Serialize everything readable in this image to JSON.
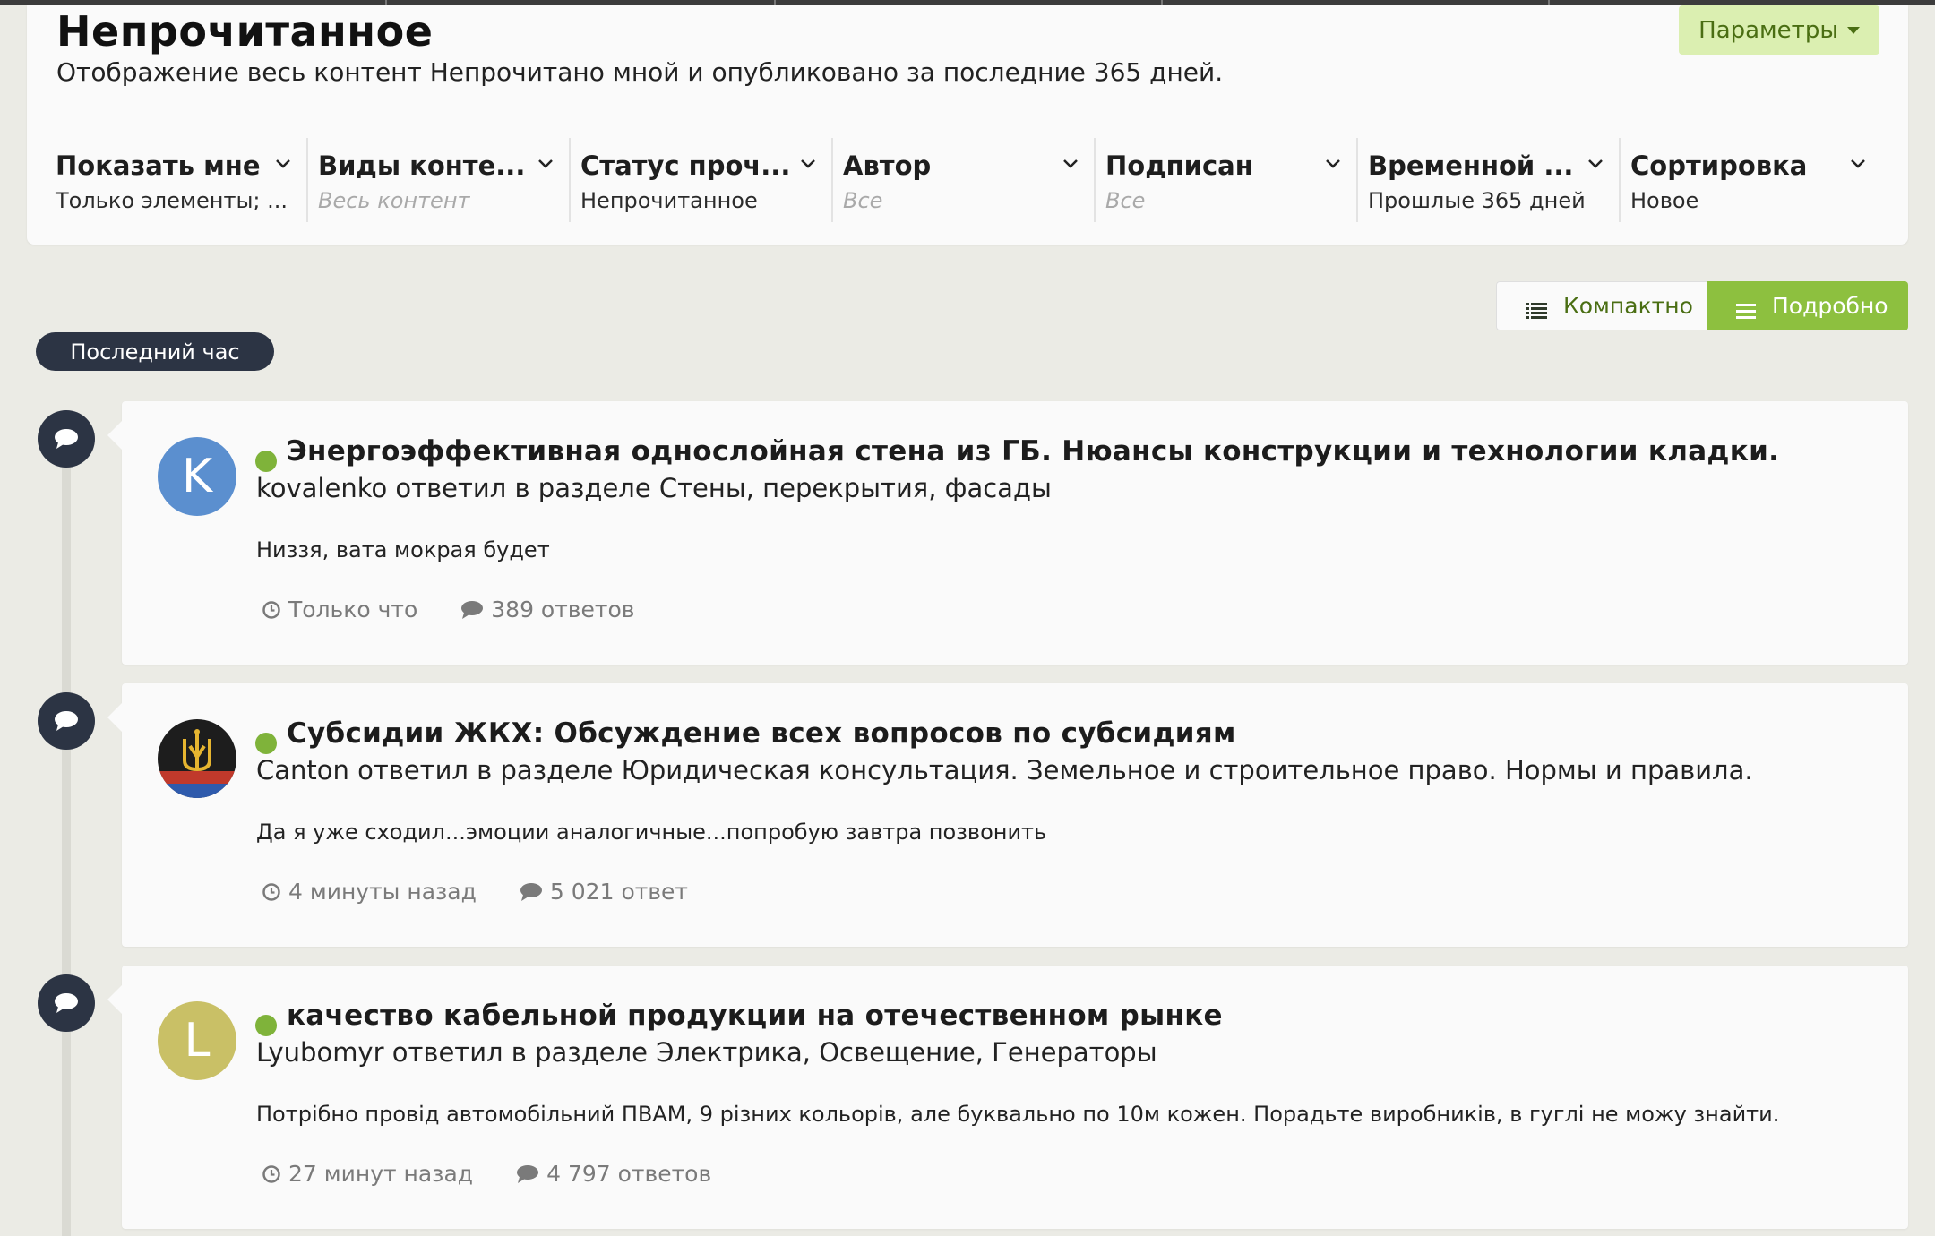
{
  "header": {
    "title": "Непрочитанное",
    "description": "Отображение весь контент Непрочитано мной и опубликовано за последние 365 дней.",
    "params_button": "Параметры"
  },
  "filters": [
    {
      "label": "Показать мне",
      "value": "Только элементы; ...",
      "placeholder": false
    },
    {
      "label": "Виды конте...",
      "value": "Весь контент",
      "placeholder": true
    },
    {
      "label": "Статус проч...",
      "value": "Непрочитанное",
      "placeholder": false
    },
    {
      "label": "Автор",
      "value": "Все",
      "placeholder": true
    },
    {
      "label": "Подписан",
      "value": "Все",
      "placeholder": true
    },
    {
      "label": "Временной ...",
      "value": "Прошлые 365 дней",
      "placeholder": false
    },
    {
      "label": "Сортировка",
      "value": "Новое",
      "placeholder": false
    }
  ],
  "view_toggle": {
    "compact": "Компактно",
    "detailed": "Подробно",
    "active": "detailed"
  },
  "time_group": "Последний час",
  "colors": {
    "accent": "#8dc03f",
    "dark": "#2c3444",
    "unread": "#7fb33a"
  },
  "activity": [
    {
      "avatar_letter": "K",
      "avatar_color": "#5b8fcf",
      "title": "Энергоэффективная однослойная стена из ГБ. Нюансы конструкции и технологии кладки.",
      "meta": "kovalenko ответил в разделе Стены, перекрытия, фасады",
      "snippet": "Низзя, вата мокрая будет",
      "time": "Только что",
      "replies": "389 ответов"
    },
    {
      "avatar_letter": "",
      "avatar_color": "#1d1d1d",
      "avatar_icon": "trident-icon",
      "title": "Субсидии ЖКХ: Обсуждение всех вопросов по субсидиям",
      "meta": "Canton ответил в разделе Юридическая консультация. Земельное и строительное право. Нормы и правила.",
      "snippet": "Да я уже сходил...эмоции аналогичные...попробую завтра позвонить",
      "time": "4 минуты назад",
      "replies": "5 021 ответ"
    },
    {
      "avatar_letter": "L",
      "avatar_color": "#c9c066",
      "title": "качество кабельной продукции на отечественном рынке",
      "meta": "Lyubomyr ответил в разделе Электрика, Освещение, Генераторы",
      "snippet": "Потрібно провід автомобільний ПВАМ, 9 різних кольорів, але буквально по 10м кожен. Порадьте виробників, в гуглі не можу знайти.",
      "time": "27 минут назад",
      "replies": "4 797 ответов"
    }
  ]
}
